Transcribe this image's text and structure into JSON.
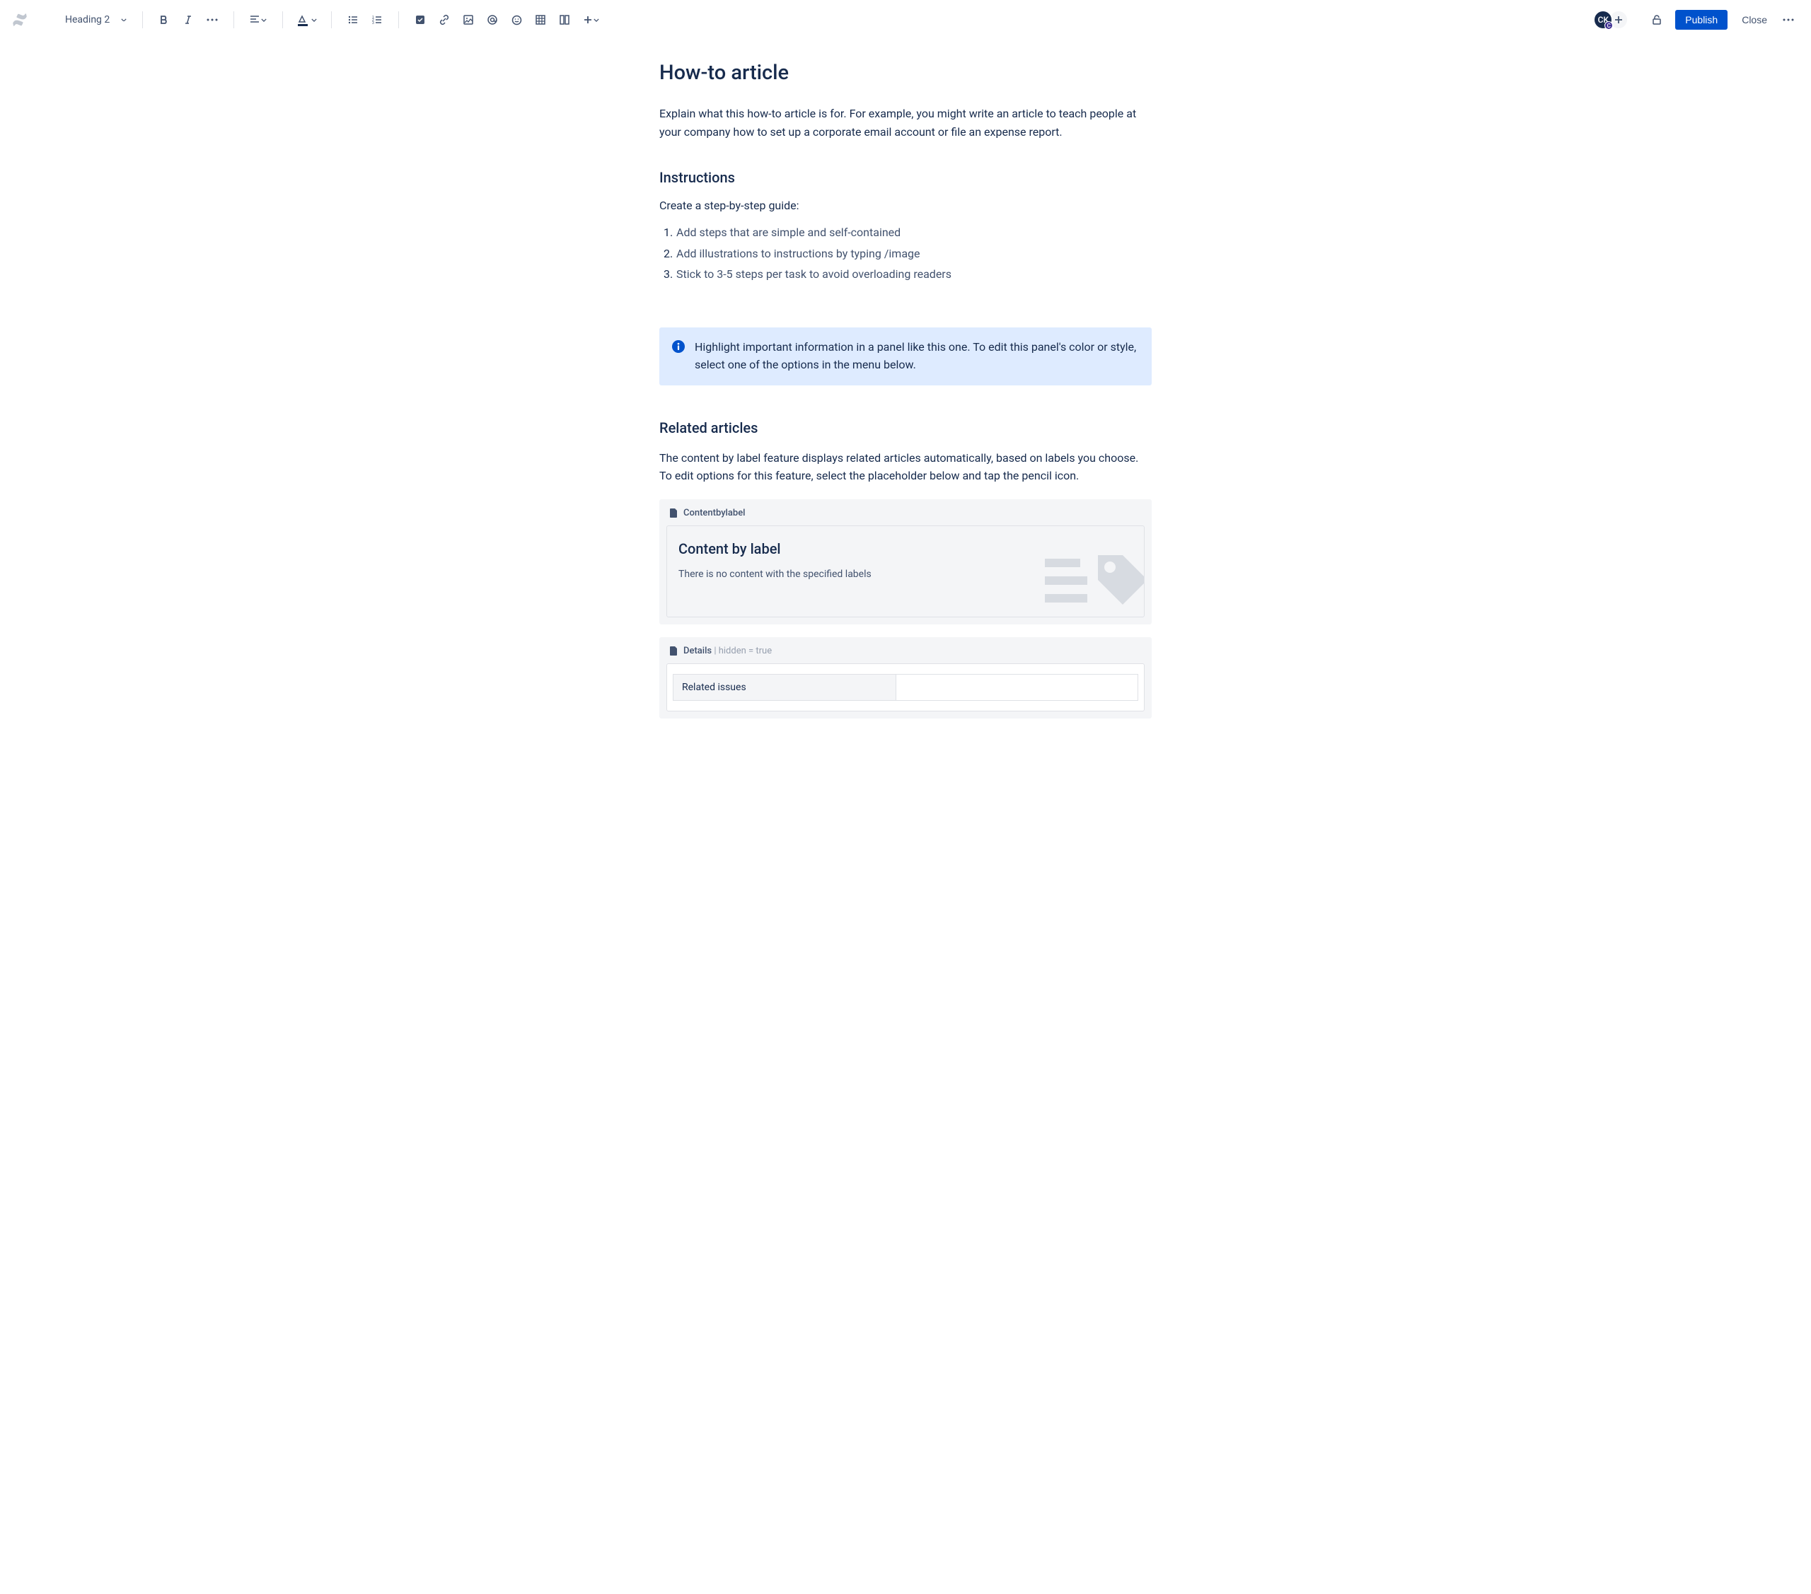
{
  "toolbar": {
    "heading_level": "Heading 2",
    "avatar_initials": "CK",
    "avatar_badge": "C",
    "publish_label": "Publish",
    "close_label": "Close"
  },
  "page": {
    "title": "How-to article",
    "intro": "Explain what this how-to article is for. For example, you might write an article to teach people at your company how to set up a corporate email account or file an expense report.",
    "instructions_heading": "Instructions",
    "instructions_subhead": "Create a step-by-step guide:",
    "steps": [
      "Add steps that are simple and self-contained",
      "Add illustrations to instructions by typing /image",
      "Stick to 3-5 steps per task to avoid overloading readers"
    ],
    "panel_text": "Highlight important information in a panel like this one. To edit this panel's color or style, select one of the options in the menu below.",
    "related_heading": "Related articles",
    "related_desc": "The content by label feature displays related articles automatically, based on labels you choose. To edit options for this feature, select the placeholder below and tap the pencil icon."
  },
  "macros": {
    "content_by_label": {
      "header": "Contentbylabel",
      "title": "Content by label",
      "empty_msg": "There is no content with the specified labels"
    },
    "details": {
      "header": "Details",
      "hidden_text": " | hidden = true",
      "row_label": "Related issues"
    }
  }
}
